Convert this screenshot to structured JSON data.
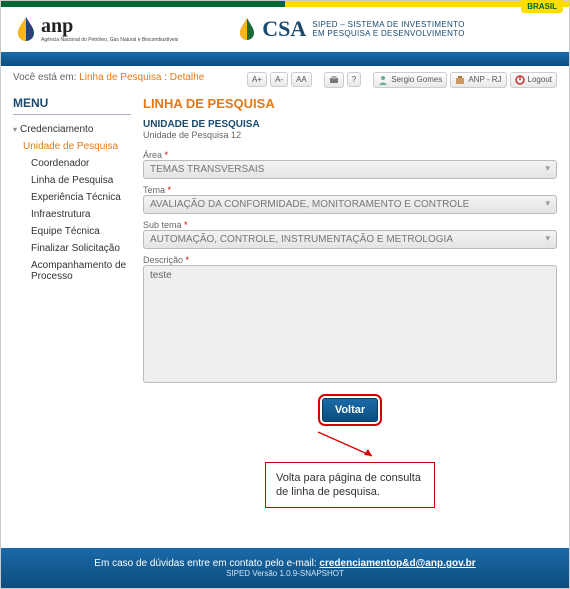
{
  "top": {
    "brasil": "BRASIL"
  },
  "header": {
    "anp_name": "anp",
    "anp_sub": "Agência Nacional do Petróleo, Gás Natural e Biocombustíveis",
    "csa_name": "CSA",
    "csa_sub1": "SIPED – SISTEMA DE INVESTIMENTO",
    "csa_sub2": "EM PESQUISA E DESENVOLVIMENTO"
  },
  "breadcrumb": {
    "prefix": "Você está em:",
    "link1": "Linha de Pesquisa",
    "link2": "Detalhe"
  },
  "toolbar": {
    "a_plus": "A+",
    "a_minus": "A-",
    "aa": "AA",
    "print_icon": "print-icon",
    "help": "?",
    "user_name": "Sergio Gomes",
    "anp_rj": "ANP - RJ",
    "logout": "Logout"
  },
  "menu": {
    "title": "MENU",
    "parent": "Credenciamento",
    "sub": "Unidade de Pesquisa",
    "items": [
      "Coordenador",
      "Linha de Pesquisa",
      "Experiência Técnica",
      "Infraestrutura",
      "Equipe Técnica",
      "Finalizar Solicitação",
      "Acompanhamento de Processo"
    ]
  },
  "main": {
    "page_title": "LINHA DE PESQUISA",
    "section_title": "UNIDADE DE PESQUISA",
    "section_sub": "Unidade de Pesquisa 12",
    "fields": {
      "area_label": "Área",
      "area_value": "TEMAS TRANSVERSAIS",
      "tema_label": "Tema",
      "tema_value": "AVALIAÇÃO DA CONFORMIDADE, MONITORAMENTO E CONTROLE",
      "subtema_label": "Sub tema",
      "subtema_value": "AUTOMAÇÃO, CONTROLE, INSTRUMENTAÇÃO E METROLOGIA",
      "desc_label": "Descrição",
      "desc_value": "teste"
    },
    "button_voltar": "Voltar"
  },
  "annotation": {
    "text": "Volta para página de consulta de linha de pesquisa."
  },
  "footer": {
    "line1_pre": "Em caso de dúvidas entre em contato pelo e-mail: ",
    "email": "credenciamentop&d@anp.gov.br",
    "version": "SIPED Versão 1.0.9-SNAPSHOT"
  }
}
